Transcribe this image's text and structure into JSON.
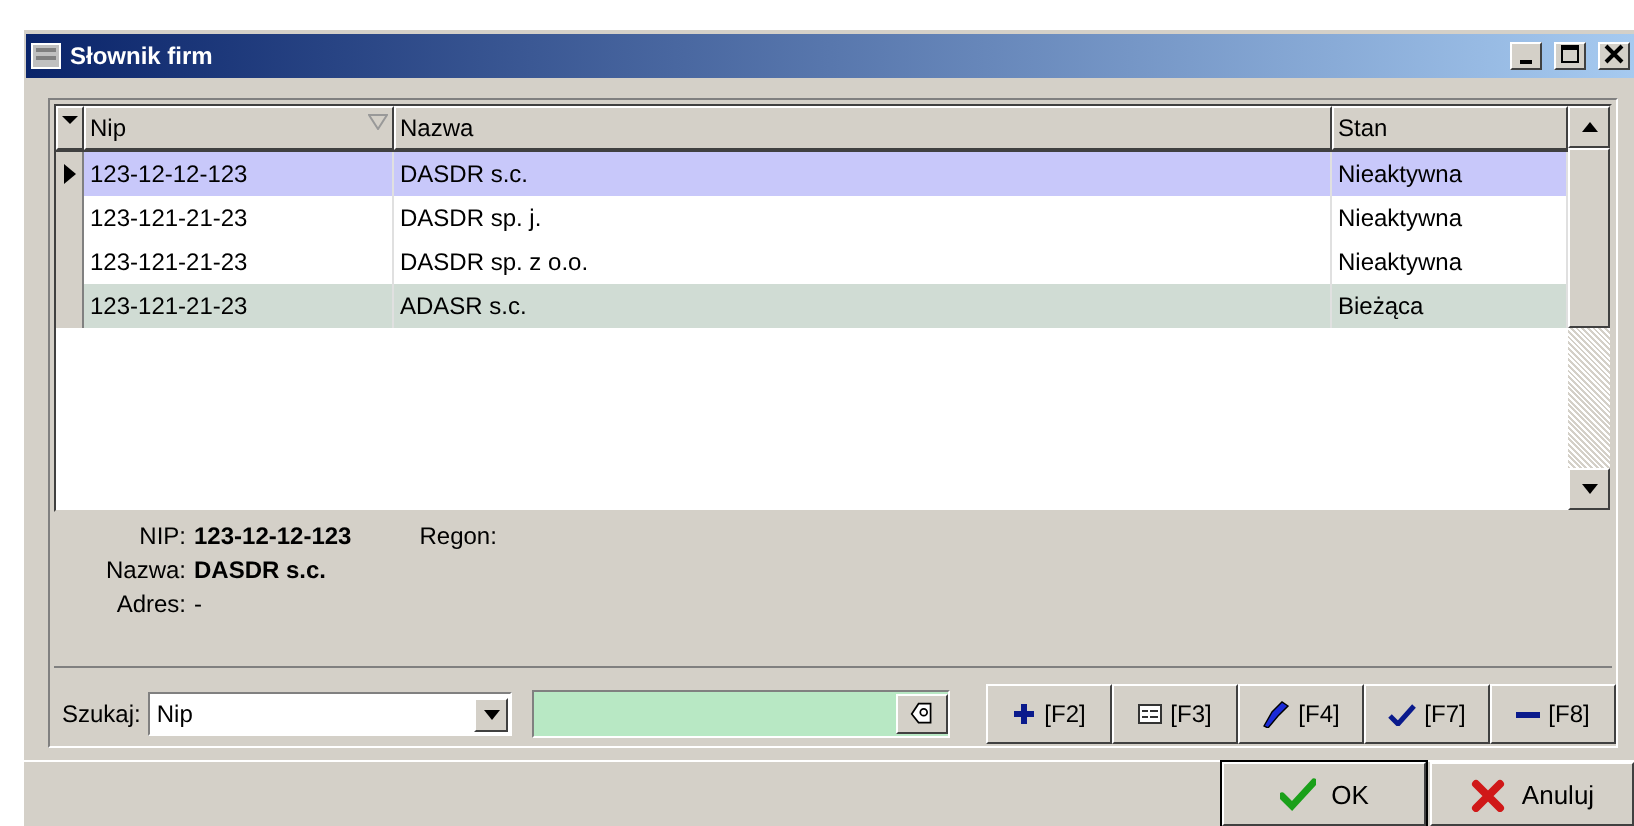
{
  "window": {
    "title": "Słownik firm"
  },
  "table": {
    "columns": [
      {
        "label": "Nip",
        "sorted": true
      },
      {
        "label": "Nazwa",
        "sorted": false
      },
      {
        "label": "Stan",
        "sorted": false
      }
    ],
    "rows": [
      {
        "cells": [
          "123-12-12-123",
          "DASDR s.c.",
          "Nieaktywna"
        ],
        "selected": true,
        "color": "#c8c8fa"
      },
      {
        "cells": [
          "123-121-21-23",
          "DASDR sp. j.",
          "Nieaktywna"
        ],
        "selected": false,
        "color": "#ffffff"
      },
      {
        "cells": [
          "123-121-21-23",
          "DASDR sp. z o.o.",
          "Nieaktywna"
        ],
        "selected": false,
        "color": "#ffffff"
      },
      {
        "cells": [
          "123-121-21-23",
          "ADASR s.c.",
          "Bieżąca"
        ],
        "selected": false,
        "color": "#d0dcd4"
      }
    ]
  },
  "details": {
    "nip_label": "NIP:",
    "nip": "123-12-12-123",
    "regon_label": "Regon:",
    "name_label": "Nazwa:",
    "name": "DASDR s.c.",
    "address_label": "Adres:",
    "address": "-"
  },
  "search": {
    "label": "Szukaj:",
    "field": "Nip"
  },
  "tool_buttons": [
    {
      "kind": "add",
      "label": "[F2]"
    },
    {
      "kind": "form",
      "label": "[F3]"
    },
    {
      "kind": "edit",
      "label": "[F4]"
    },
    {
      "kind": "check",
      "label": "[F7]"
    },
    {
      "kind": "remove",
      "label": "[F8]"
    }
  ],
  "dialog_buttons": [
    {
      "kind": "ok",
      "label": "OK"
    },
    {
      "kind": "cancel",
      "label": "Anuluj"
    }
  ]
}
